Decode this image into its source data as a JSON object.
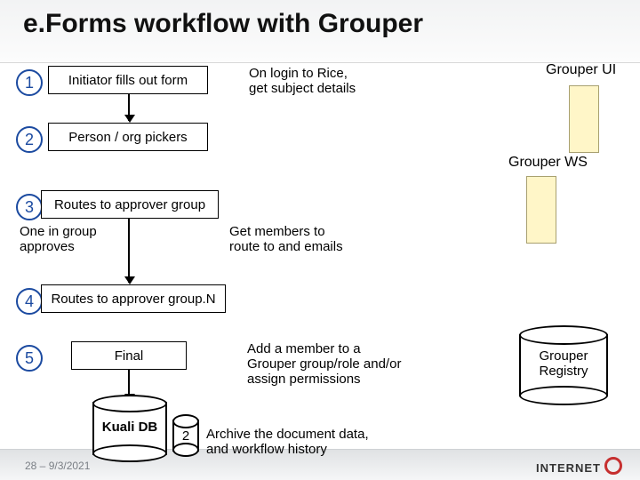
{
  "title": "e.Forms workflow with Grouper",
  "steps": [
    {
      "num": "1",
      "label": "Initiator fills out form"
    },
    {
      "num": "2",
      "label": "Person / org pickers"
    },
    {
      "num": "3",
      "label": "Routes to approver group"
    },
    {
      "num": "4",
      "label": "Routes to approver group.N"
    },
    {
      "num": "5",
      "label": "Final"
    }
  ],
  "descriptions": {
    "login": "On login to Rice,\nget subject details",
    "one_in_group": "One in group\napproves",
    "get_members": "Get members to\nroute to and emails",
    "add_member": "Add a member to a\nGrouper group/role and/or\nassign permissions",
    "archive": "Archive the document data,\nand workflow history"
  },
  "right_labels": {
    "ui": "Grouper UI",
    "ws": "Grouper WS",
    "registry": "Grouper\nRegistry"
  },
  "db_labels": {
    "kuali": "Kuali DB",
    "small": "2"
  },
  "footer": "28 – 9/3/2021",
  "logo_text": "INTERNET"
}
